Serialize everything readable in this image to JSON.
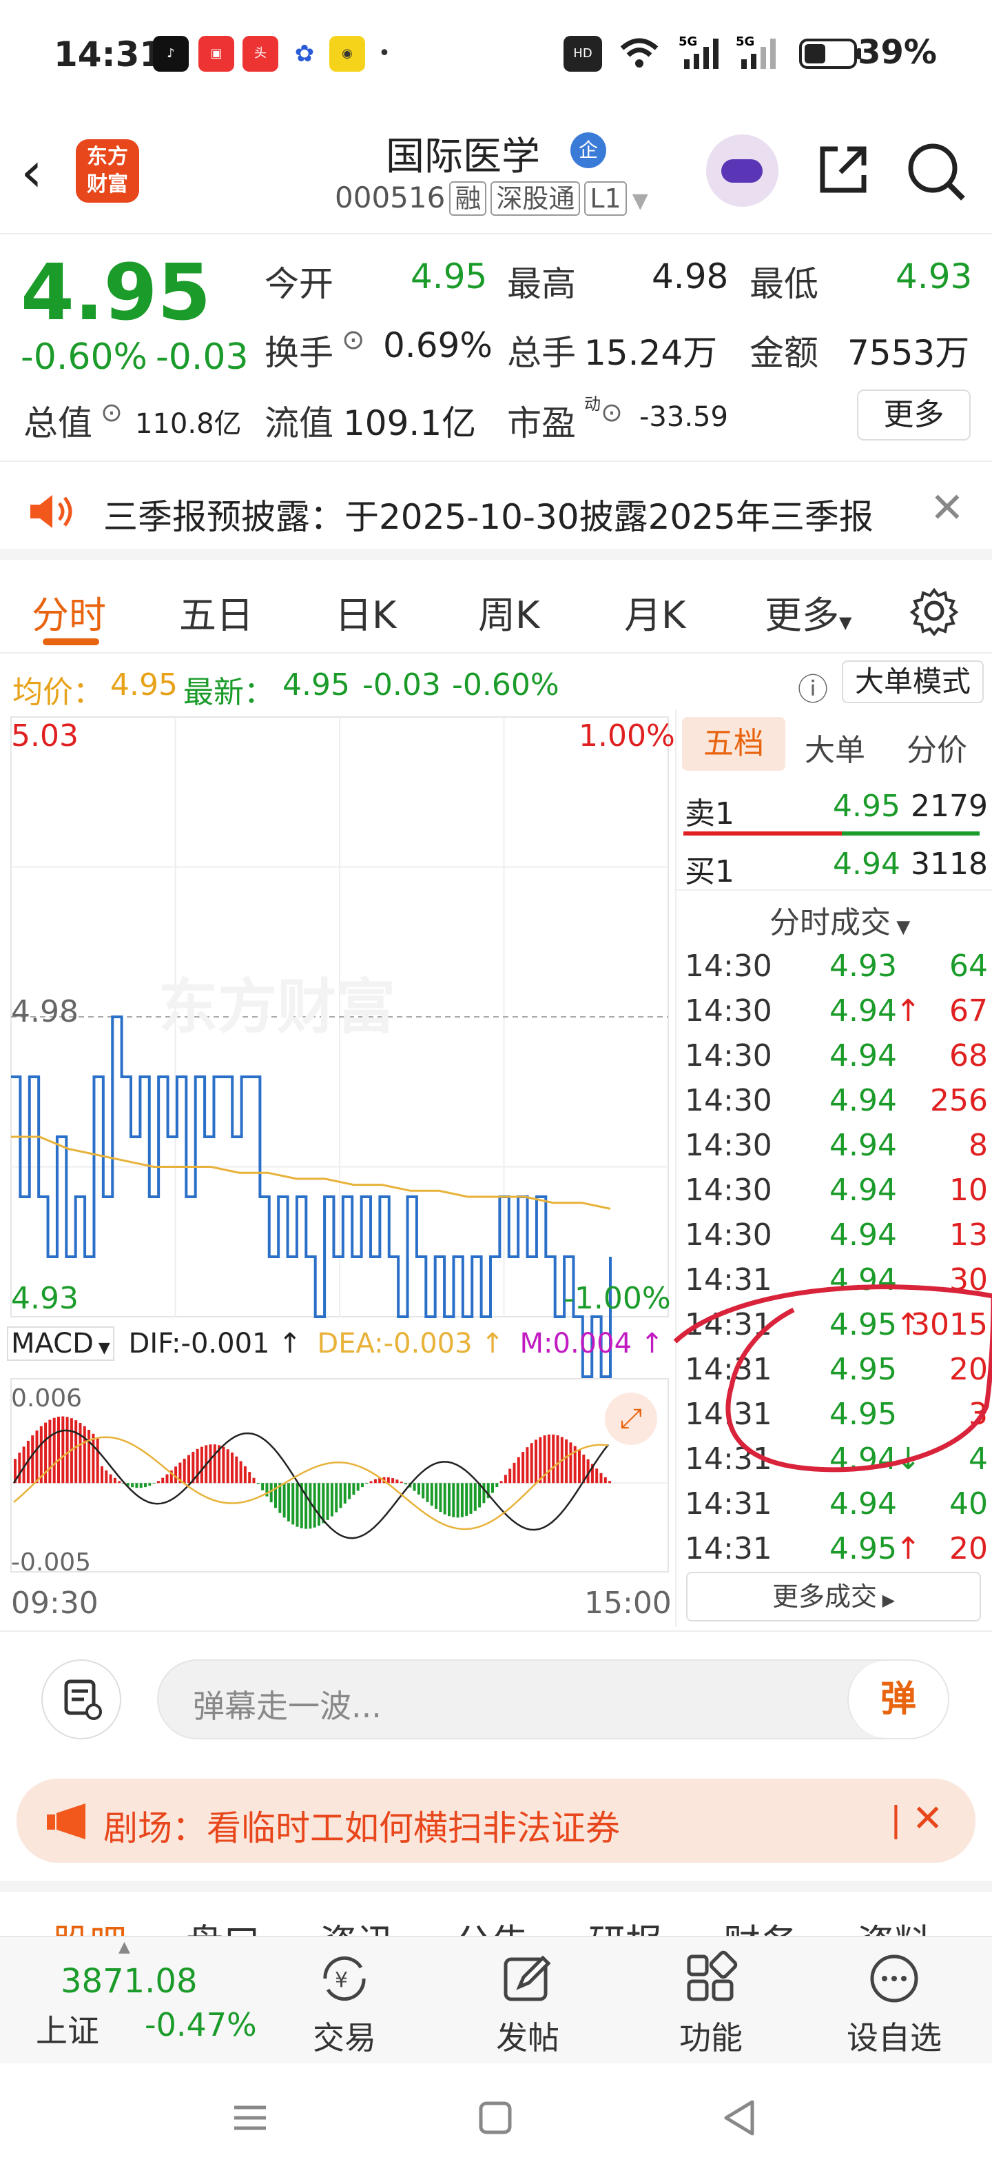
{
  "status_bar": {
    "time": "14:31",
    "battery": "39%",
    "signal": "5G"
  },
  "header": {
    "title": "国际医学",
    "badge": "企",
    "code": "000516",
    "tags": [
      "融",
      "深股通",
      "L1"
    ],
    "logo_text": "东方财富"
  },
  "quote": {
    "price": "4.95",
    "change_pct": "-0.60%",
    "change": "-0.03",
    "open_label": "今开",
    "open": "4.95",
    "high_label": "最高",
    "high": "4.98",
    "low_label": "最低",
    "low": "4.93",
    "turnover_label": "换手",
    "turnover": "0.69%",
    "volume_label": "总手",
    "volume": "15.24万",
    "amount_label": "金额",
    "amount": "7553万",
    "mcap_label": "总值",
    "mcap": "110.8亿",
    "float_label": "流值",
    "float_mcap": "109.1亿",
    "pe_label": "市盈",
    "pe_sup": "动",
    "pe": "-33.59",
    "more": "更多"
  },
  "notice": {
    "text": "三季报预披露：于2025-10-30披露2025年三季报"
  },
  "tabs": [
    "分时",
    "五日",
    "日K",
    "周K",
    "月K",
    "更多"
  ],
  "avg_bar": {
    "avg_label": "均价：",
    "avg": "4.95",
    "latest_label": "最新：",
    "latest": "4.95",
    "chg": "-0.03",
    "pct": "-0.60%",
    "mode_button": "大单模式"
  },
  "chart_data": {
    "type": "line",
    "price_axis": {
      "top": "5.03",
      "mid": "4.98",
      "bottom": "4.93"
    },
    "pct_axis": {
      "top": "1.00%",
      "bottom": "-1.00%"
    },
    "time_axis": {
      "start": "09:30",
      "end": "15:00"
    },
    "watermark": "东方财富",
    "series": [
      {
        "values": [
          4.97,
          4.95,
          4.97,
          4.95,
          4.94,
          4.96,
          4.94,
          4.95,
          4.94,
          4.97,
          4.95,
          4.98,
          4.97,
          4.96,
          4.97,
          4.95,
          4.97,
          4.96,
          4.97,
          4.95,
          4.97,
          4.96,
          4.97,
          4.97,
          4.96,
          4.97,
          4.97,
          4.95,
          4.94,
          4.95,
          4.94,
          4.95,
          4.94,
          4.93,
          4.95,
          4.94,
          4.95,
          4.94,
          4.95,
          4.94,
          4.95,
          4.94,
          4.93,
          4.95,
          4.94,
          4.93,
          4.94,
          4.93,
          4.94,
          4.93,
          4.94,
          4.93,
          4.94,
          4.95,
          4.94,
          4.95,
          4.94,
          4.95,
          4.94,
          4.93,
          4.94,
          4.93,
          4.92,
          4.93,
          4.92,
          4.94
        ]
      },
      {
        "values": [
          4.96,
          4.96,
          4.958,
          4.957,
          4.956,
          4.955,
          4.955,
          4.955,
          4.954,
          4.954,
          4.953,
          4.953,
          4.952,
          4.952,
          4.951,
          4.951,
          4.95,
          4.95,
          4.95,
          4.949,
          4.949,
          4.948
        ]
      }
    ]
  },
  "macd": {
    "label": "MACD",
    "dif": "DIF:-0.001",
    "dea": "DEA:-0.003",
    "m": "M:0.004",
    "axis_top": "0.006",
    "axis_bottom": "-0.005"
  },
  "order_book": {
    "tabs": [
      "五档",
      "大单",
      "分价"
    ],
    "sell": {
      "label": "卖1",
      "price": "4.95",
      "vol": "2179"
    },
    "buy": {
      "label": "买1",
      "price": "4.94",
      "vol": "3118"
    }
  },
  "ticks_header": "分时成交",
  "ticks": [
    {
      "t": "14:30",
      "p": "4.93",
      "v": "64",
      "vc": "green",
      "arrow": ""
    },
    {
      "t": "14:30",
      "p": "4.94",
      "v": "67",
      "vc": "red",
      "arrow": "↑"
    },
    {
      "t": "14:30",
      "p": "4.94",
      "v": "68",
      "vc": "red",
      "arrow": ""
    },
    {
      "t": "14:30",
      "p": "4.94",
      "v": "256",
      "vc": "red",
      "arrow": ""
    },
    {
      "t": "14:30",
      "p": "4.94",
      "v": "8",
      "vc": "red",
      "arrow": ""
    },
    {
      "t": "14:30",
      "p": "4.94",
      "v": "10",
      "vc": "red",
      "arrow": ""
    },
    {
      "t": "14:30",
      "p": "4.94",
      "v": "13",
      "vc": "red",
      "arrow": ""
    },
    {
      "t": "14:31",
      "p": "4.94",
      "v": "30",
      "vc": "red",
      "arrow": ""
    },
    {
      "t": "14:31",
      "p": "4.95",
      "v": "3015",
      "vc": "red",
      "arrow": "↑"
    },
    {
      "t": "14:31",
      "p": "4.95",
      "v": "20",
      "vc": "red",
      "arrow": ""
    },
    {
      "t": "14:31",
      "p": "4.95",
      "v": "3",
      "vc": "red",
      "arrow": ""
    },
    {
      "t": "14:31",
      "p": "4.94",
      "v": "4",
      "vc": "green",
      "arrow": "↓"
    },
    {
      "t": "14:31",
      "p": "4.94",
      "v": "40",
      "vc": "green",
      "arrow": ""
    },
    {
      "t": "14:31",
      "p": "4.95",
      "v": "20",
      "vc": "red",
      "arrow": "↑"
    }
  ],
  "more_ticks": "更多成交",
  "danmaku": {
    "placeholder": "弹幕走一波...",
    "send": "弹"
  },
  "banner": {
    "text": "剧场：看临时工如何横扫非法证券"
  },
  "sub_tabs": [
    "股吧",
    "盘口",
    "资讯",
    "公告",
    "研报",
    "财务",
    "资料"
  ],
  "bottom_nav": {
    "index_value": "3871.08",
    "index_name": "上证",
    "index_pct": "-0.47%",
    "items": [
      "交易",
      "发帖",
      "功能",
      "设自选"
    ]
  },
  "colors": {
    "up": "#e02020",
    "down": "#1b9b2a",
    "accent": "#e8640e",
    "price_line": "#2a6fc8",
    "avg_line": "#e8b23a"
  }
}
